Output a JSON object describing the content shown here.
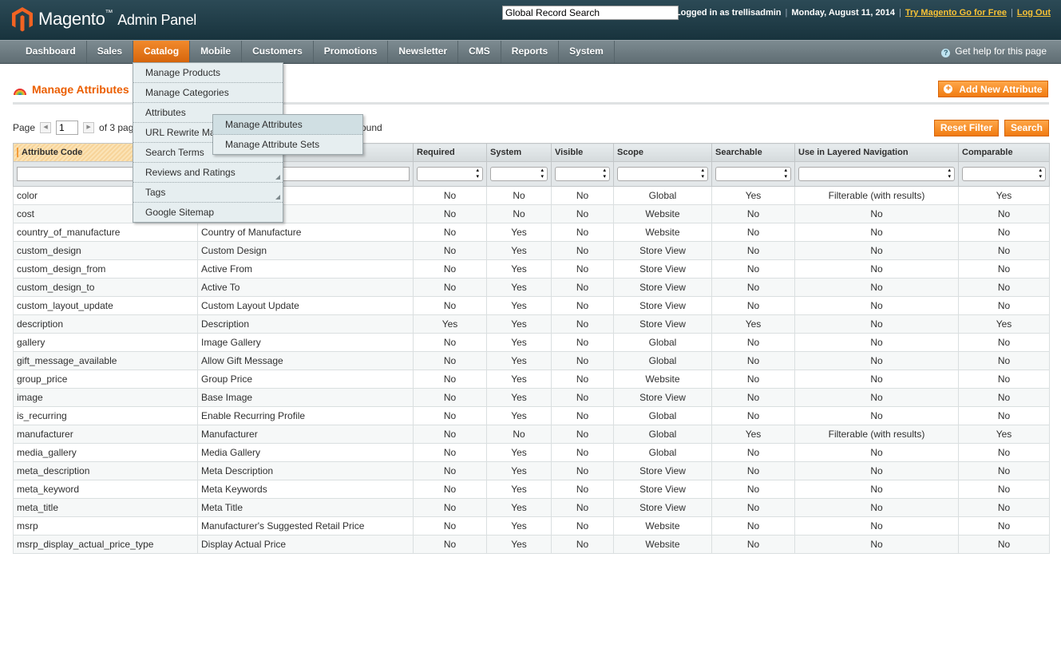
{
  "header": {
    "logo_text": "Magento",
    "logo_sub": "Admin Panel",
    "search_value": "Global Record Search",
    "logged_in": "Logged in as trellisadmin",
    "date": "Monday, August 11, 2014",
    "try_link": "Try Magento Go for Free",
    "logout": "Log Out"
  },
  "nav": {
    "items": [
      "Dashboard",
      "Sales",
      "Catalog",
      "Mobile",
      "Customers",
      "Promotions",
      "Newsletter",
      "CMS",
      "Reports",
      "System"
    ],
    "active": "Catalog",
    "help": "Get help for this page"
  },
  "catalog_menu": [
    "Manage Products",
    "Manage Categories",
    "Attributes",
    "URL Rewrite Ma",
    "Search Terms",
    "Reviews and Ratings",
    "Tags",
    "Google Sitemap"
  ],
  "attributes_submenu": [
    "Manage Attributes",
    "Manage Attribute Sets"
  ],
  "page": {
    "title": "Manage Attributes",
    "add_button": "Add New Attribute"
  },
  "pager": {
    "label": "Page",
    "value": "1",
    "of_text": "of 3 pag",
    "found_text": "ound"
  },
  "buttons": {
    "reset": "Reset Filter",
    "search": "Search"
  },
  "grid": {
    "columns": [
      "Attribute Code",
      "",
      "Required",
      "System",
      "Visible",
      "Scope",
      "Searchable",
      "Use in Layered Navigation",
      "Comparable"
    ],
    "rows": [
      [
        "color",
        "",
        "No",
        "No",
        "No",
        "Global",
        "Yes",
        "Filterable (with results)",
        "Yes"
      ],
      [
        "cost",
        "",
        "No",
        "No",
        "No",
        "Website",
        "No",
        "No",
        "No"
      ],
      [
        "country_of_manufacture",
        "Country of Manufacture",
        "No",
        "Yes",
        "No",
        "Website",
        "No",
        "No",
        "No"
      ],
      [
        "custom_design",
        "Custom Design",
        "No",
        "Yes",
        "No",
        "Store View",
        "No",
        "No",
        "No"
      ],
      [
        "custom_design_from",
        "Active From",
        "No",
        "Yes",
        "No",
        "Store View",
        "No",
        "No",
        "No"
      ],
      [
        "custom_design_to",
        "Active To",
        "No",
        "Yes",
        "No",
        "Store View",
        "No",
        "No",
        "No"
      ],
      [
        "custom_layout_update",
        "Custom Layout Update",
        "No",
        "Yes",
        "No",
        "Store View",
        "No",
        "No",
        "No"
      ],
      [
        "description",
        "Description",
        "Yes",
        "Yes",
        "No",
        "Store View",
        "Yes",
        "No",
        "Yes"
      ],
      [
        "gallery",
        "Image Gallery",
        "No",
        "Yes",
        "No",
        "Global",
        "No",
        "No",
        "No"
      ],
      [
        "gift_message_available",
        "Allow Gift Message",
        "No",
        "Yes",
        "No",
        "Global",
        "No",
        "No",
        "No"
      ],
      [
        "group_price",
        "Group Price",
        "No",
        "Yes",
        "No",
        "Website",
        "No",
        "No",
        "No"
      ],
      [
        "image",
        "Base Image",
        "No",
        "Yes",
        "No",
        "Store View",
        "No",
        "No",
        "No"
      ],
      [
        "is_recurring",
        "Enable Recurring Profile",
        "No",
        "Yes",
        "No",
        "Global",
        "No",
        "No",
        "No"
      ],
      [
        "manufacturer",
        "Manufacturer",
        "No",
        "No",
        "No",
        "Global",
        "Yes",
        "Filterable (with results)",
        "Yes"
      ],
      [
        "media_gallery",
        "Media Gallery",
        "No",
        "Yes",
        "No",
        "Global",
        "No",
        "No",
        "No"
      ],
      [
        "meta_description",
        "Meta Description",
        "No",
        "Yes",
        "No",
        "Store View",
        "No",
        "No",
        "No"
      ],
      [
        "meta_keyword",
        "Meta Keywords",
        "No",
        "Yes",
        "No",
        "Store View",
        "No",
        "No",
        "No"
      ],
      [
        "meta_title",
        "Meta Title",
        "No",
        "Yes",
        "No",
        "Store View",
        "No",
        "No",
        "No"
      ],
      [
        "msrp",
        "Manufacturer's Suggested Retail Price",
        "No",
        "Yes",
        "No",
        "Website",
        "No",
        "No",
        "No"
      ],
      [
        "msrp_display_actual_price_type",
        "Display Actual Price",
        "No",
        "Yes",
        "No",
        "Website",
        "No",
        "No",
        "No"
      ]
    ]
  }
}
